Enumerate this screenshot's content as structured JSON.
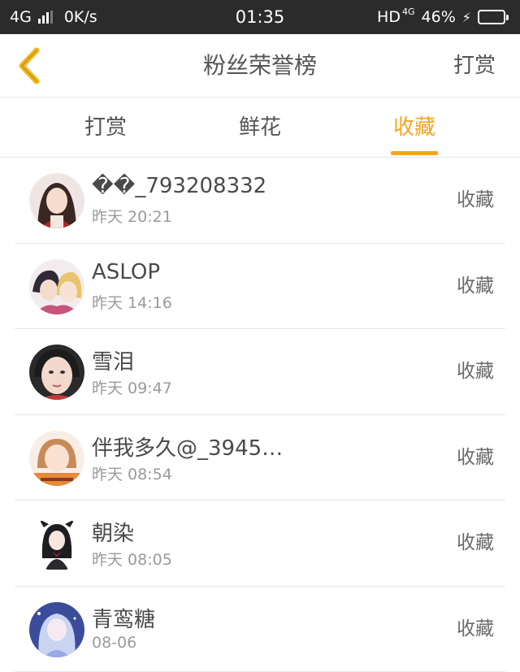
{
  "status_bar": {
    "network": "4G",
    "speed": "0K/s",
    "time": "01:35",
    "hd": "HD",
    "net_sup": "4G",
    "battery": "46%",
    "battery_level": 0.46,
    "icons": [
      "signal-icon",
      "battery-icon",
      "charging-icon"
    ]
  },
  "header": {
    "title": "粉丝荣誉榜",
    "action": "打赏",
    "back_icon": "chevron-left-icon",
    "accent_color": "#f5a51f"
  },
  "tabs": [
    {
      "label": "打赏",
      "active": false
    },
    {
      "label": "鲜花",
      "active": false
    },
    {
      "label": "收藏",
      "active": true
    }
  ],
  "list": [
    {
      "name": "��_793208332",
      "time": "昨天 20:21",
      "action": "收藏",
      "avatar": "avatar-icon"
    },
    {
      "name": "ASLOP",
      "time": "昨天 14:16",
      "action": "收藏",
      "avatar": "avatar-icon"
    },
    {
      "name": "雪泪",
      "time": "昨天 09:47",
      "action": "收藏",
      "avatar": "avatar-icon"
    },
    {
      "name": "伴我多久@_3945…",
      "time": "昨天 08:54",
      "action": "收藏",
      "avatar": "avatar-icon"
    },
    {
      "name": "朝染",
      "time": "昨天 08:05",
      "action": "收藏",
      "avatar": "avatar-icon"
    },
    {
      "name": "青鸾糖",
      "time": "08-06",
      "action": "收藏",
      "avatar": "avatar-icon"
    }
  ]
}
